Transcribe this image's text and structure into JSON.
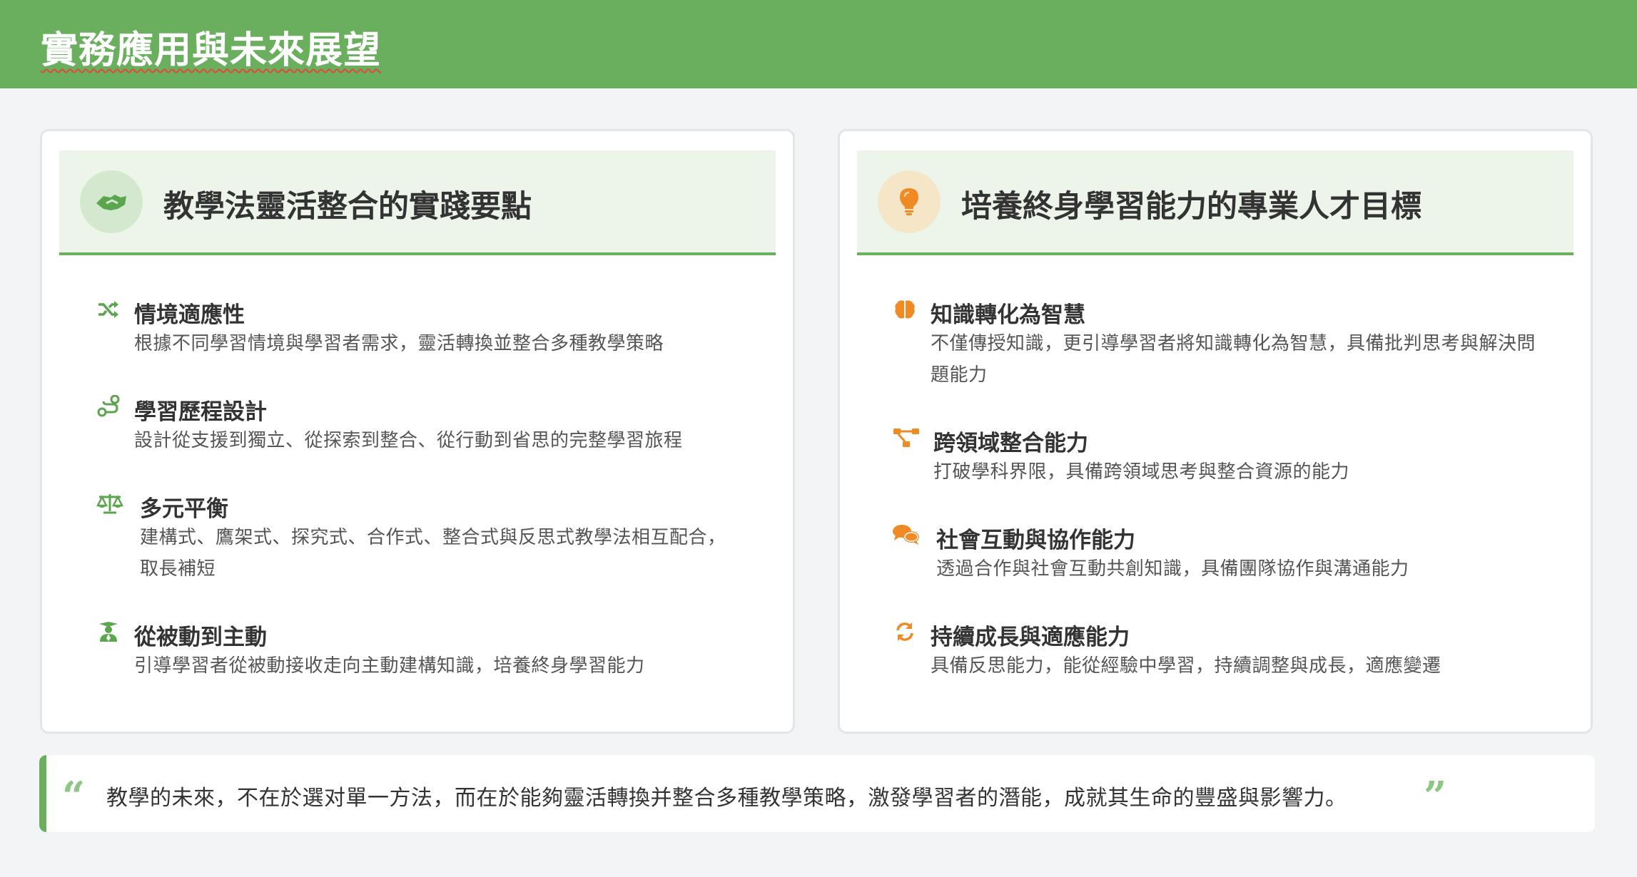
{
  "header": {
    "title": "實務應用與未來展望"
  },
  "colors": {
    "accent": "#6aaf5e",
    "orange": "#f08a24"
  },
  "left_card": {
    "title": "教學法靈活整合的實踐要點",
    "icon": "handshake-icon",
    "items": [
      {
        "icon": "shuffle-icon",
        "title": "情境適應性",
        "desc": "根據不同學習情境與學習者需求，靈活轉換並整合多種教學策略"
      },
      {
        "icon": "route-icon",
        "title": "學習歷程設計",
        "desc": "設計從支援到獨立、從探索到整合、從行動到省思的完整學習旅程"
      },
      {
        "icon": "balance-scale-icon",
        "title": "多元平衡",
        "desc": "建構式、鷹架式、探究式、合作式、整合式與反思式教學法相互配合，取長補短"
      },
      {
        "icon": "graduate-icon",
        "title": "從被動到主動",
        "desc": "引導學習者從被動接收走向主動建構知識，培養終身學習能力"
      }
    ]
  },
  "right_card": {
    "title": "培養終身學習能力的專業人才目標",
    "icon": "lightbulb-icon",
    "items": [
      {
        "icon": "brain-icon",
        "title": "知識轉化為智慧",
        "desc": "不僅傳授知識，更引導學習者將知識轉化為智慧，具備批判思考與解決問題能力"
      },
      {
        "icon": "project-diagram-icon",
        "title": "跨領域整合能力",
        "desc": "打破學科界限，具備跨領域思考與整合資源的能力"
      },
      {
        "icon": "comments-icon",
        "title": "社會互動與協作能力",
        "desc": "透過合作與社會互動共創知識，具備團隊協作與溝通能力"
      },
      {
        "icon": "sync-icon",
        "title": "持續成長與適應能力",
        "desc": "具備反思能力，能從經驗中學習，持續調整與成長，適應變遷"
      }
    ]
  },
  "quote": {
    "open": "“",
    "text": "教學的未來，不在於選对單一方法，而在於能夠靈活轉換并整合多種教學策略，激發學習者的潛能，成就其生命的豐盛與影響力。",
    "close": "”"
  }
}
